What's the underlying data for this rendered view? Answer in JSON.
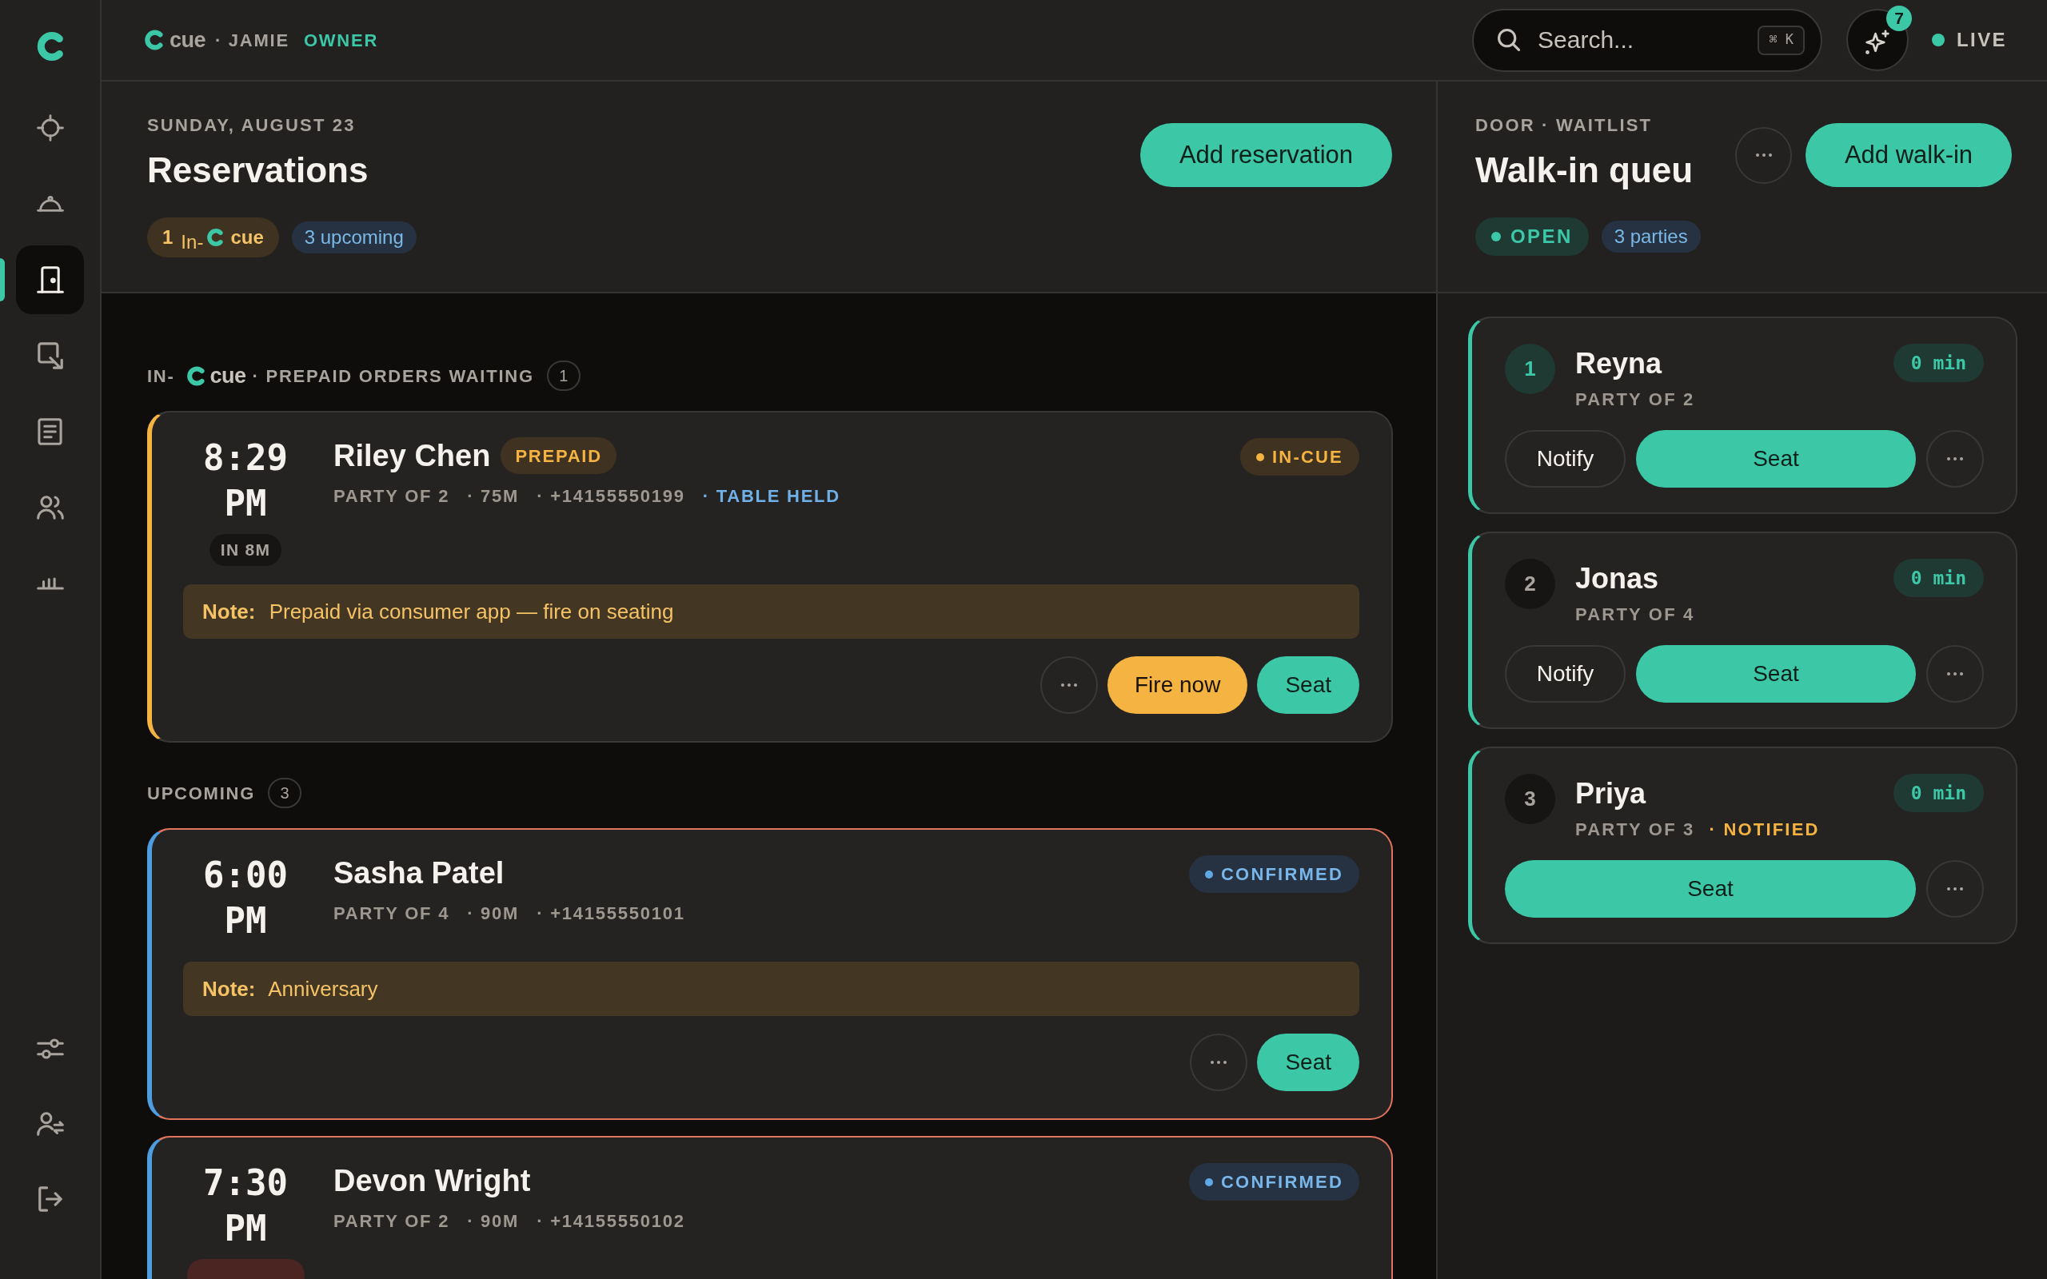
{
  "sidebar": {
    "items": [
      {
        "selected": false
      },
      {
        "selected": false
      },
      {
        "selected": true
      },
      {
        "selected": false
      },
      {
        "selected": false
      },
      {
        "selected": false
      },
      {
        "selected": false
      }
    ],
    "footer_items": [
      {
        "selected": false
      },
      {
        "selected": false
      },
      {
        "selected": false
      }
    ]
  },
  "topbar": {
    "brand": "cue",
    "user": "· JAMIE",
    "role": "OWNER",
    "search": {
      "placeholder": "Search...",
      "shortcut": "⌘ K"
    },
    "assistant_badge": "7",
    "live": {
      "label": "LIVE",
      "on": true
    }
  },
  "reservations": {
    "eyebrow": "SUNDAY, AUGUST 23",
    "title": "Reservations",
    "add_button": "Add reservation",
    "summary": [
      {
        "kind": "in_cue",
        "count": "1",
        "prefix": "In-",
        "brand": "cue"
      },
      {
        "kind": "count",
        "label": "3 upcoming"
      }
    ],
    "sections": [
      {
        "kind": "in_cue",
        "prefix": "IN-",
        "brand": "cue",
        "label": "· PREPAID ORDERS WAITING",
        "count": "1",
        "cards": [
          {
            "time": "8:29",
            "period": "PM",
            "countdown": {
              "kind": "soon",
              "text": "IN 8M"
            },
            "name": "Riley Chen",
            "tag": "PREPAID",
            "meta": [
              {
                "kind": "muted",
                "text": "PARTY OF 2"
              },
              {
                "kind": "muted",
                "text": "· 75M"
              },
              {
                "kind": "muted",
                "text": "· +14155550199"
              },
              {
                "kind": "info",
                "text": "· TABLE HELD"
              }
            ],
            "status": {
              "kind": "in_cue",
              "label": "IN-CUE"
            },
            "overdue": false,
            "note": "**Note:** Prepaid via consumer app — fire on seating",
            "actions": [
              {
                "kind": "more"
              },
              {
                "kind": "fire",
                "label": "Fire now"
              },
              {
                "kind": "seat",
                "label": "Seat"
              }
            ]
          }
        ]
      },
      {
        "kind": "plain",
        "label": "UPCOMING",
        "count": "3",
        "cards": [
          {
            "time": "6:00",
            "period": "PM",
            "name": "Sasha Patel",
            "meta": [
              {
                "kind": "muted",
                "text": "PARTY OF 4"
              },
              {
                "kind": "muted",
                "text": "· 90M"
              },
              {
                "kind": "muted",
                "text": "· +14155550101"
              }
            ],
            "status": {
              "kind": "confirmed",
              "label": "CONFIRMED"
            },
            "overdue": true,
            "note": "**Note:** Anniversary",
            "actions": [
              {
                "kind": "more"
              },
              {
                "kind": "seat",
                "label": "Seat"
              }
            ]
          },
          {
            "time": "7:30",
            "period": "PM",
            "countdown": {
              "kind": "late"
            },
            "name": "Devon Wright",
            "meta": [
              {
                "kind": "muted",
                "text": "PARTY OF 2"
              },
              {
                "kind": "muted",
                "text": "· 90M"
              },
              {
                "kind": "muted",
                "text": "· +14155550102"
              }
            ],
            "status": {
              "kind": "confirmed",
              "label": "CONFIRMED"
            },
            "overdue": true
          }
        ]
      }
    ]
  },
  "waitlist": {
    "eyebrow": "DOOR · WAITLIST",
    "title": "Walk-in queu",
    "add_button": "Add walk-in",
    "summary": [
      {
        "kind": "open",
        "label": "OPEN"
      },
      {
        "kind": "count",
        "label": "3 parties"
      }
    ],
    "parties": [
      {
        "rank": "1",
        "next": true,
        "name": "Reyna",
        "party": "PARTY OF 2",
        "wait": "0 min",
        "actions": [
          {
            "kind": "notify",
            "label": "Notify"
          },
          {
            "kind": "seat",
            "label": "Seat"
          },
          {
            "kind": "more"
          }
        ]
      },
      {
        "rank": "2",
        "next": false,
        "name": "Jonas",
        "party": "PARTY OF 4",
        "wait": "0 min",
        "actions": [
          {
            "kind": "notify",
            "label": "Notify"
          },
          {
            "kind": "seat",
            "label": "Seat"
          },
          {
            "kind": "more"
          }
        ]
      },
      {
        "rank": "3",
        "next": false,
        "name": "Priya",
        "party": "PARTY OF 3",
        "flag": "· NOTIFIED",
        "wait": "0 min",
        "actions": [
          {
            "kind": "seat",
            "label": "Seat"
          },
          {
            "kind": "more"
          }
        ]
      }
    ]
  }
}
